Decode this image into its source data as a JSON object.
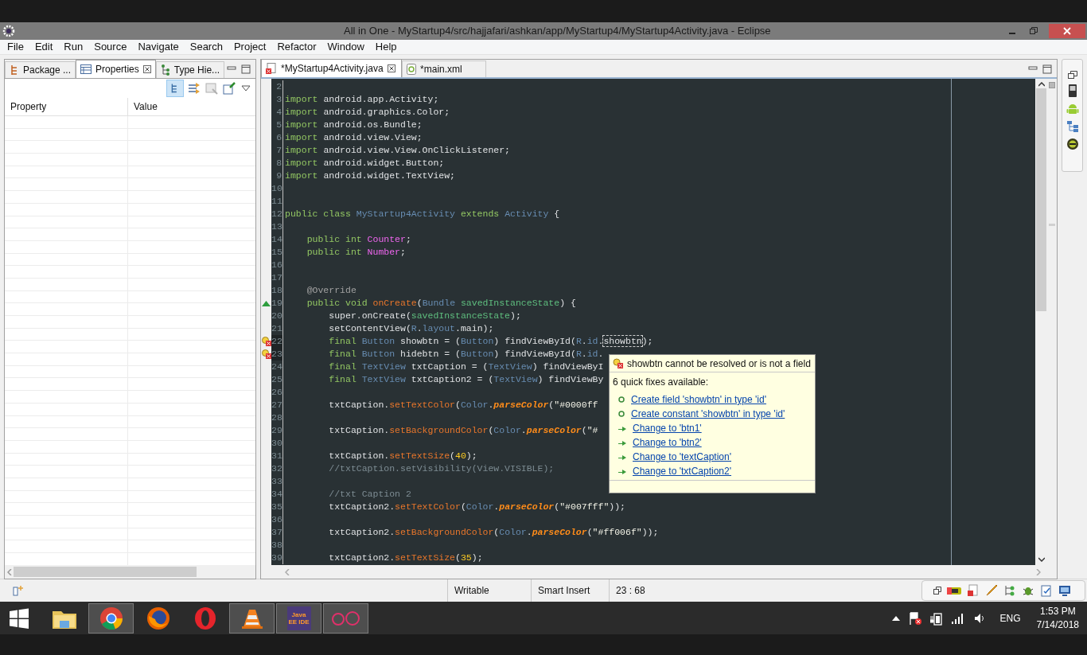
{
  "window": {
    "title": "All in One - MyStartup4/src/hajjafari/ashkan/app/MyStartup4/MyStartup4Activity.java - Eclipse"
  },
  "menu": [
    "File",
    "Edit",
    "Run",
    "Source",
    "Navigate",
    "Search",
    "Project",
    "Refactor",
    "Window",
    "Help"
  ],
  "left_panel": {
    "tabs": [
      {
        "label": "Package ...",
        "kind": "package",
        "selected": false
      },
      {
        "label": "Properties",
        "kind": "properties",
        "selected": true
      },
      {
        "label": "Type Hie...",
        "kind": "hierarchy",
        "selected": false
      }
    ],
    "columns": [
      "Property",
      "Value"
    ]
  },
  "editor": {
    "tabs": [
      {
        "label": "*MyStartup4Activity.java",
        "kind": "java",
        "selected": true
      },
      {
        "label": "*main.xml",
        "kind": "xml",
        "selected": false
      }
    ],
    "lines": [
      {
        "number": "2",
        "kind": "code"
      },
      {
        "number": "3",
        "kind": "code",
        "tokens": [
          {
            "kind": "kw",
            "text": "import"
          },
          {
            "kind": "plain",
            "text": " android.app.Activity;"
          }
        ]
      },
      {
        "number": "4",
        "kind": "code",
        "tokens": [
          {
            "kind": "kw",
            "text": "import"
          },
          {
            "kind": "plain",
            "text": " android.graphics.Color;"
          }
        ]
      },
      {
        "number": "5",
        "kind": "code",
        "tokens": [
          {
            "kind": "kw",
            "text": "import"
          },
          {
            "kind": "plain",
            "text": " android.os.Bundle;"
          }
        ]
      },
      {
        "number": "6",
        "kind": "code",
        "tokens": [
          {
            "kind": "kw",
            "text": "import"
          },
          {
            "kind": "plain",
            "text": " android.view.View;"
          }
        ]
      },
      {
        "number": "7",
        "kind": "code",
        "tokens": [
          {
            "kind": "kw",
            "text": "import"
          },
          {
            "kind": "plain",
            "text": " android.view.View.OnClickListener;"
          }
        ]
      },
      {
        "number": "8",
        "kind": "code",
        "tokens": [
          {
            "kind": "kw",
            "text": "import"
          },
          {
            "kind": "plain",
            "text": " android.widget.Button;"
          }
        ]
      },
      {
        "number": "9",
        "kind": "code",
        "tokens": [
          {
            "kind": "kw",
            "text": "import"
          },
          {
            "kind": "plain",
            "text": " android.widget.TextView;"
          }
        ]
      },
      {
        "number": "10",
        "kind": "code"
      },
      {
        "number": "11",
        "kind": "code"
      },
      {
        "number": "12",
        "kind": "code",
        "tokens": [
          {
            "kind": "kw",
            "text": "public class"
          },
          {
            "kind": "type",
            "text": " MyStartup4Activity"
          },
          {
            "kind": "kw",
            "text": " extends"
          },
          {
            "kind": "type",
            "text": " Activity"
          },
          {
            "kind": "plain",
            "text": " {"
          }
        ]
      },
      {
        "number": "13",
        "kind": "code"
      },
      {
        "number": "14",
        "kind": "code",
        "tokens": [
          {
            "kind": "kw",
            "text": "    public int"
          },
          {
            "kind": "field",
            "text": " Counter"
          },
          {
            "kind": "plain",
            "text": ";"
          }
        ]
      },
      {
        "number": "15",
        "kind": "code",
        "tokens": [
          {
            "kind": "kw",
            "text": "    public int"
          },
          {
            "kind": "field",
            "text": " Number"
          },
          {
            "kind": "plain",
            "text": ";"
          }
        ]
      },
      {
        "number": "16",
        "kind": "code"
      },
      {
        "number": "17",
        "kind": "code"
      },
      {
        "number": "18",
        "kind": "code",
        "tokens": [
          {
            "kind": "annot",
            "text": "    @Override"
          }
        ]
      },
      {
        "number": "19",
        "kind": "override",
        "tokens": [
          {
            "kind": "kw",
            "text": "    public void"
          },
          {
            "kind": "method",
            "text": " onCreate"
          },
          {
            "kind": "plain",
            "text": "("
          },
          {
            "kind": "type",
            "text": "Bundle"
          },
          {
            "kind": "param",
            "text": " savedInstanceState"
          },
          {
            "kind": "plain",
            "text": ") {"
          }
        ]
      },
      {
        "number": "20",
        "kind": "code",
        "tokens": [
          {
            "kind": "plain",
            "text": "        super.onCreate("
          },
          {
            "kind": "param",
            "text": "savedInstanceState"
          },
          {
            "kind": "plain",
            "text": ");"
          }
        ]
      },
      {
        "number": "21",
        "kind": "code",
        "tokens": [
          {
            "kind": "plain",
            "text": "        setContentView("
          },
          {
            "kind": "type",
            "text": "R"
          },
          {
            "kind": "plain",
            "text": "."
          },
          {
            "kind": "type",
            "text": "layout"
          },
          {
            "kind": "plain",
            "text": ".main);"
          }
        ]
      },
      {
        "number": "22",
        "kind": "error",
        "tokens": [
          {
            "kind": "kw",
            "text": "        final"
          },
          {
            "kind": "type",
            "text": " Button"
          },
          {
            "kind": "plain",
            "text": " showbtn = ("
          },
          {
            "kind": "type",
            "text": "Button"
          },
          {
            "kind": "plain",
            "text": ") findViewById("
          },
          {
            "kind": "type",
            "text": "R"
          },
          {
            "kind": "plain",
            "text": "."
          },
          {
            "kind": "type",
            "text": "id"
          },
          {
            "kind": "plain",
            "text": "."
          },
          {
            "kind": "error",
            "text": "showbtn"
          },
          {
            "kind": "plain",
            "text": ");"
          }
        ]
      },
      {
        "number": "23",
        "kind": "error",
        "tokens": [
          {
            "kind": "kw",
            "text": "        final"
          },
          {
            "kind": "type",
            "text": " Button"
          },
          {
            "kind": "plain",
            "text": " hidebtn = ("
          },
          {
            "kind": "type",
            "text": "Button"
          },
          {
            "kind": "plain",
            "text": ") findViewById("
          },
          {
            "kind": "type",
            "text": "R"
          },
          {
            "kind": "plain",
            "text": "."
          },
          {
            "kind": "type",
            "text": "id"
          },
          {
            "kind": "plain",
            "text": "."
          }
        ]
      },
      {
        "number": "24",
        "kind": "code",
        "tokens": [
          {
            "kind": "kw",
            "text": "        final"
          },
          {
            "kind": "type",
            "text": " TextView"
          },
          {
            "kind": "plain",
            "text": " txtCaption = ("
          },
          {
            "kind": "type",
            "text": "TextView"
          },
          {
            "kind": "plain",
            "text": ") findViewByI"
          }
        ]
      },
      {
        "number": "25",
        "kind": "code",
        "tokens": [
          {
            "kind": "kw",
            "text": "        final"
          },
          {
            "kind": "type",
            "text": " TextView"
          },
          {
            "kind": "plain",
            "text": " txtCaption2 = ("
          },
          {
            "kind": "type",
            "text": "TextView"
          },
          {
            "kind": "plain",
            "text": ") findViewBy"
          }
        ]
      },
      {
        "number": "26",
        "kind": "code"
      },
      {
        "number": "27",
        "kind": "code",
        "tokens": [
          {
            "kind": "plain",
            "text": "        txtCaption."
          },
          {
            "kind": "method",
            "text": "setTextColor"
          },
          {
            "kind": "plain",
            "text": "("
          },
          {
            "kind": "type",
            "text": "Color"
          },
          {
            "kind": "plain",
            "text": "."
          },
          {
            "kind": "static",
            "text": "parseColor"
          },
          {
            "kind": "plain",
            "text": "("
          },
          {
            "kind": "string",
            "text": "\"#0000ff"
          }
        ]
      },
      {
        "number": "28",
        "kind": "code"
      },
      {
        "number": "29",
        "kind": "code",
        "tokens": [
          {
            "kind": "plain",
            "text": "        txtCaption."
          },
          {
            "kind": "method",
            "text": "setBackgroundColor"
          },
          {
            "kind": "plain",
            "text": "("
          },
          {
            "kind": "type",
            "text": "Color"
          },
          {
            "kind": "plain",
            "text": "."
          },
          {
            "kind": "static",
            "text": "parseColor"
          },
          {
            "kind": "plain",
            "text": "("
          },
          {
            "kind": "string",
            "text": "\"#"
          }
        ]
      },
      {
        "number": "30",
        "kind": "code"
      },
      {
        "number": "31",
        "kind": "code",
        "tokens": [
          {
            "kind": "plain",
            "text": "        txtCaption."
          },
          {
            "kind": "method",
            "text": "setTextSize"
          },
          {
            "kind": "plain",
            "text": "("
          },
          {
            "kind": "number",
            "text": "40"
          },
          {
            "kind": "plain",
            "text": ");"
          }
        ]
      },
      {
        "number": "32",
        "kind": "code",
        "tokens": [
          {
            "kind": "comment",
            "text": "        //txtCaption.setVisibility(View.VISIBLE);"
          }
        ]
      },
      {
        "number": "33",
        "kind": "code"
      },
      {
        "number": "34",
        "kind": "code",
        "tokens": [
          {
            "kind": "comment",
            "text": "        //txt Caption 2"
          }
        ]
      },
      {
        "number": "35",
        "kind": "code",
        "tokens": [
          {
            "kind": "plain",
            "text": "        txtCaption2."
          },
          {
            "kind": "method",
            "text": "setTextColor"
          },
          {
            "kind": "plain",
            "text": "("
          },
          {
            "kind": "type",
            "text": "Color"
          },
          {
            "kind": "plain",
            "text": "."
          },
          {
            "kind": "static",
            "text": "parseColor"
          },
          {
            "kind": "plain",
            "text": "("
          },
          {
            "kind": "string",
            "text": "\"#007fff\""
          },
          {
            "kind": "plain",
            "text": "));"
          }
        ]
      },
      {
        "number": "36",
        "kind": "code"
      },
      {
        "number": "37",
        "kind": "code",
        "tokens": [
          {
            "kind": "plain",
            "text": "        txtCaption2."
          },
          {
            "kind": "method",
            "text": "setBackgroundColor"
          },
          {
            "kind": "plain",
            "text": "("
          },
          {
            "kind": "type",
            "text": "Color"
          },
          {
            "kind": "plain",
            "text": "."
          },
          {
            "kind": "static",
            "text": "parseColor"
          },
          {
            "kind": "plain",
            "text": "("
          },
          {
            "kind": "string",
            "text": "\"#ff006f\""
          },
          {
            "kind": "plain",
            "text": "));"
          }
        ]
      },
      {
        "number": "38",
        "kind": "code"
      },
      {
        "number": "39",
        "kind": "code",
        "tokens": [
          {
            "kind": "plain",
            "text": "        txtCaption2."
          },
          {
            "kind": "method",
            "text": "setTextSize"
          },
          {
            "kind": "plain",
            "text": "("
          },
          {
            "kind": "number",
            "text": "35"
          },
          {
            "kind": "plain",
            "text": ");"
          }
        ]
      }
    ]
  },
  "tooltip": {
    "title": "showbtn cannot be resolved or is not a field",
    "subtitle": "6 quick fixes available:",
    "fixes": [
      {
        "kind": "create",
        "label": "Create field 'showbtn' in type 'id'"
      },
      {
        "kind": "create",
        "label": "Create constant 'showbtn' in type 'id'"
      },
      {
        "kind": "change",
        "label": "Change to 'btn1'"
      },
      {
        "kind": "change",
        "label": "Change to 'btn2'"
      },
      {
        "kind": "change",
        "label": "Change to 'textCaption'"
      },
      {
        "kind": "change",
        "label": "Change to 'txtCaption2'"
      }
    ]
  },
  "status_bar": [
    "Writable",
    "Smart Insert",
    "23 : 68"
  ],
  "taskbar": {
    "apps": [
      {
        "kind": "explorer",
        "selected": false
      },
      {
        "kind": "chrome",
        "selected": true
      },
      {
        "kind": "firefox",
        "selected": false
      },
      {
        "kind": "opera",
        "selected": false
      },
      {
        "kind": "vlc",
        "selected": true
      },
      {
        "kind": "javaee",
        "label": "Java EE IDE",
        "selected": true
      },
      {
        "kind": "glasses",
        "selected": true
      }
    ],
    "language": "ENG",
    "time": "1:53 PM",
    "date": "7/14/2018"
  }
}
